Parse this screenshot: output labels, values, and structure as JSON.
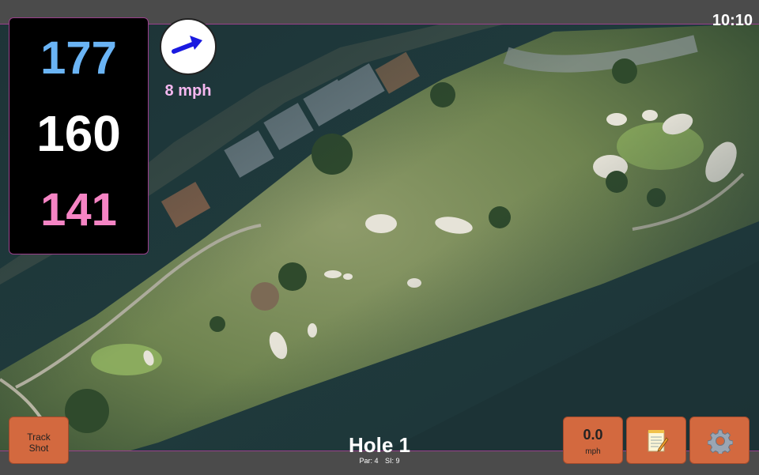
{
  "clock": "10:10",
  "distances": {
    "back": "177",
    "middle": "160",
    "front": "141"
  },
  "wind": {
    "speed_label": "8 mph",
    "direction_icon": "arrow-icon",
    "color": "#f6b8f0"
  },
  "track_button": {
    "line1": "Track",
    "line2": "Shot"
  },
  "hole": {
    "title": "Hole 1",
    "par": "Par: 4",
    "si": "SI: 9"
  },
  "speed_button": {
    "value": "0.0",
    "unit": "mph"
  },
  "notes_button": {
    "icon": "notepad-icon"
  },
  "settings_button": {
    "icon": "gear-icon"
  },
  "colors": {
    "back": "#6ab4f5",
    "middle": "#ffffff",
    "front": "#f584c4",
    "button": "#d3693f",
    "bar": "#4b4b4b",
    "accent_border": "#9b3f8c"
  }
}
